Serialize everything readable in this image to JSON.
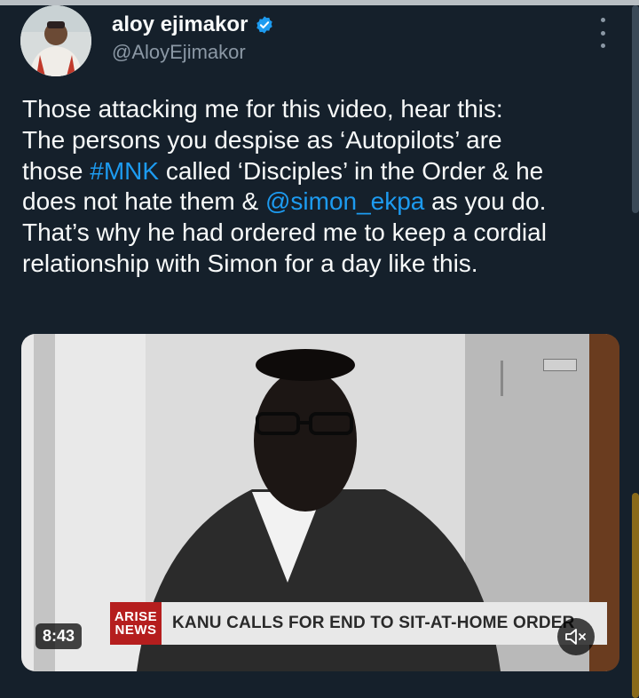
{
  "user": {
    "name": "aloy ejimakor",
    "handle": "@AloyEjimakor",
    "verified": true
  },
  "tweet": {
    "lines": [
      [
        {
          "t": "Those attacking me for this video, hear this:"
        }
      ],
      [
        {
          "t": "The persons you despise as ‘Autopilots’ are"
        }
      ],
      [
        {
          "t": "those "
        },
        {
          "t": "#MNK",
          "link": true
        },
        {
          "t": " called ‘Disciples’ in the Order & he"
        }
      ],
      [
        {
          "t": "does not hate them & "
        },
        {
          "t": "@simon_ekpa",
          "link": true
        },
        {
          "t": " as you do."
        }
      ],
      [
        {
          "t": "That’s why he had ordered me to keep a cordial"
        }
      ],
      [
        {
          "t": "relationship with Simon for a day like this."
        }
      ]
    ]
  },
  "video": {
    "ticker_logo_top": "ARISE",
    "ticker_logo_bottom": "NEWS",
    "ticker_text": "KANU CALLS FOR END TO SIT-AT-HOME ORDER",
    "duration": "8:43"
  },
  "icons": {
    "verified": "verified-badge-icon",
    "more": "more-vertical-icon",
    "mute": "volume-muted-icon"
  },
  "colors": {
    "background": "#15202b",
    "link": "#1d9bf0",
    "verified": "#1d9bf0",
    "secondary_text": "#8b98a5"
  }
}
